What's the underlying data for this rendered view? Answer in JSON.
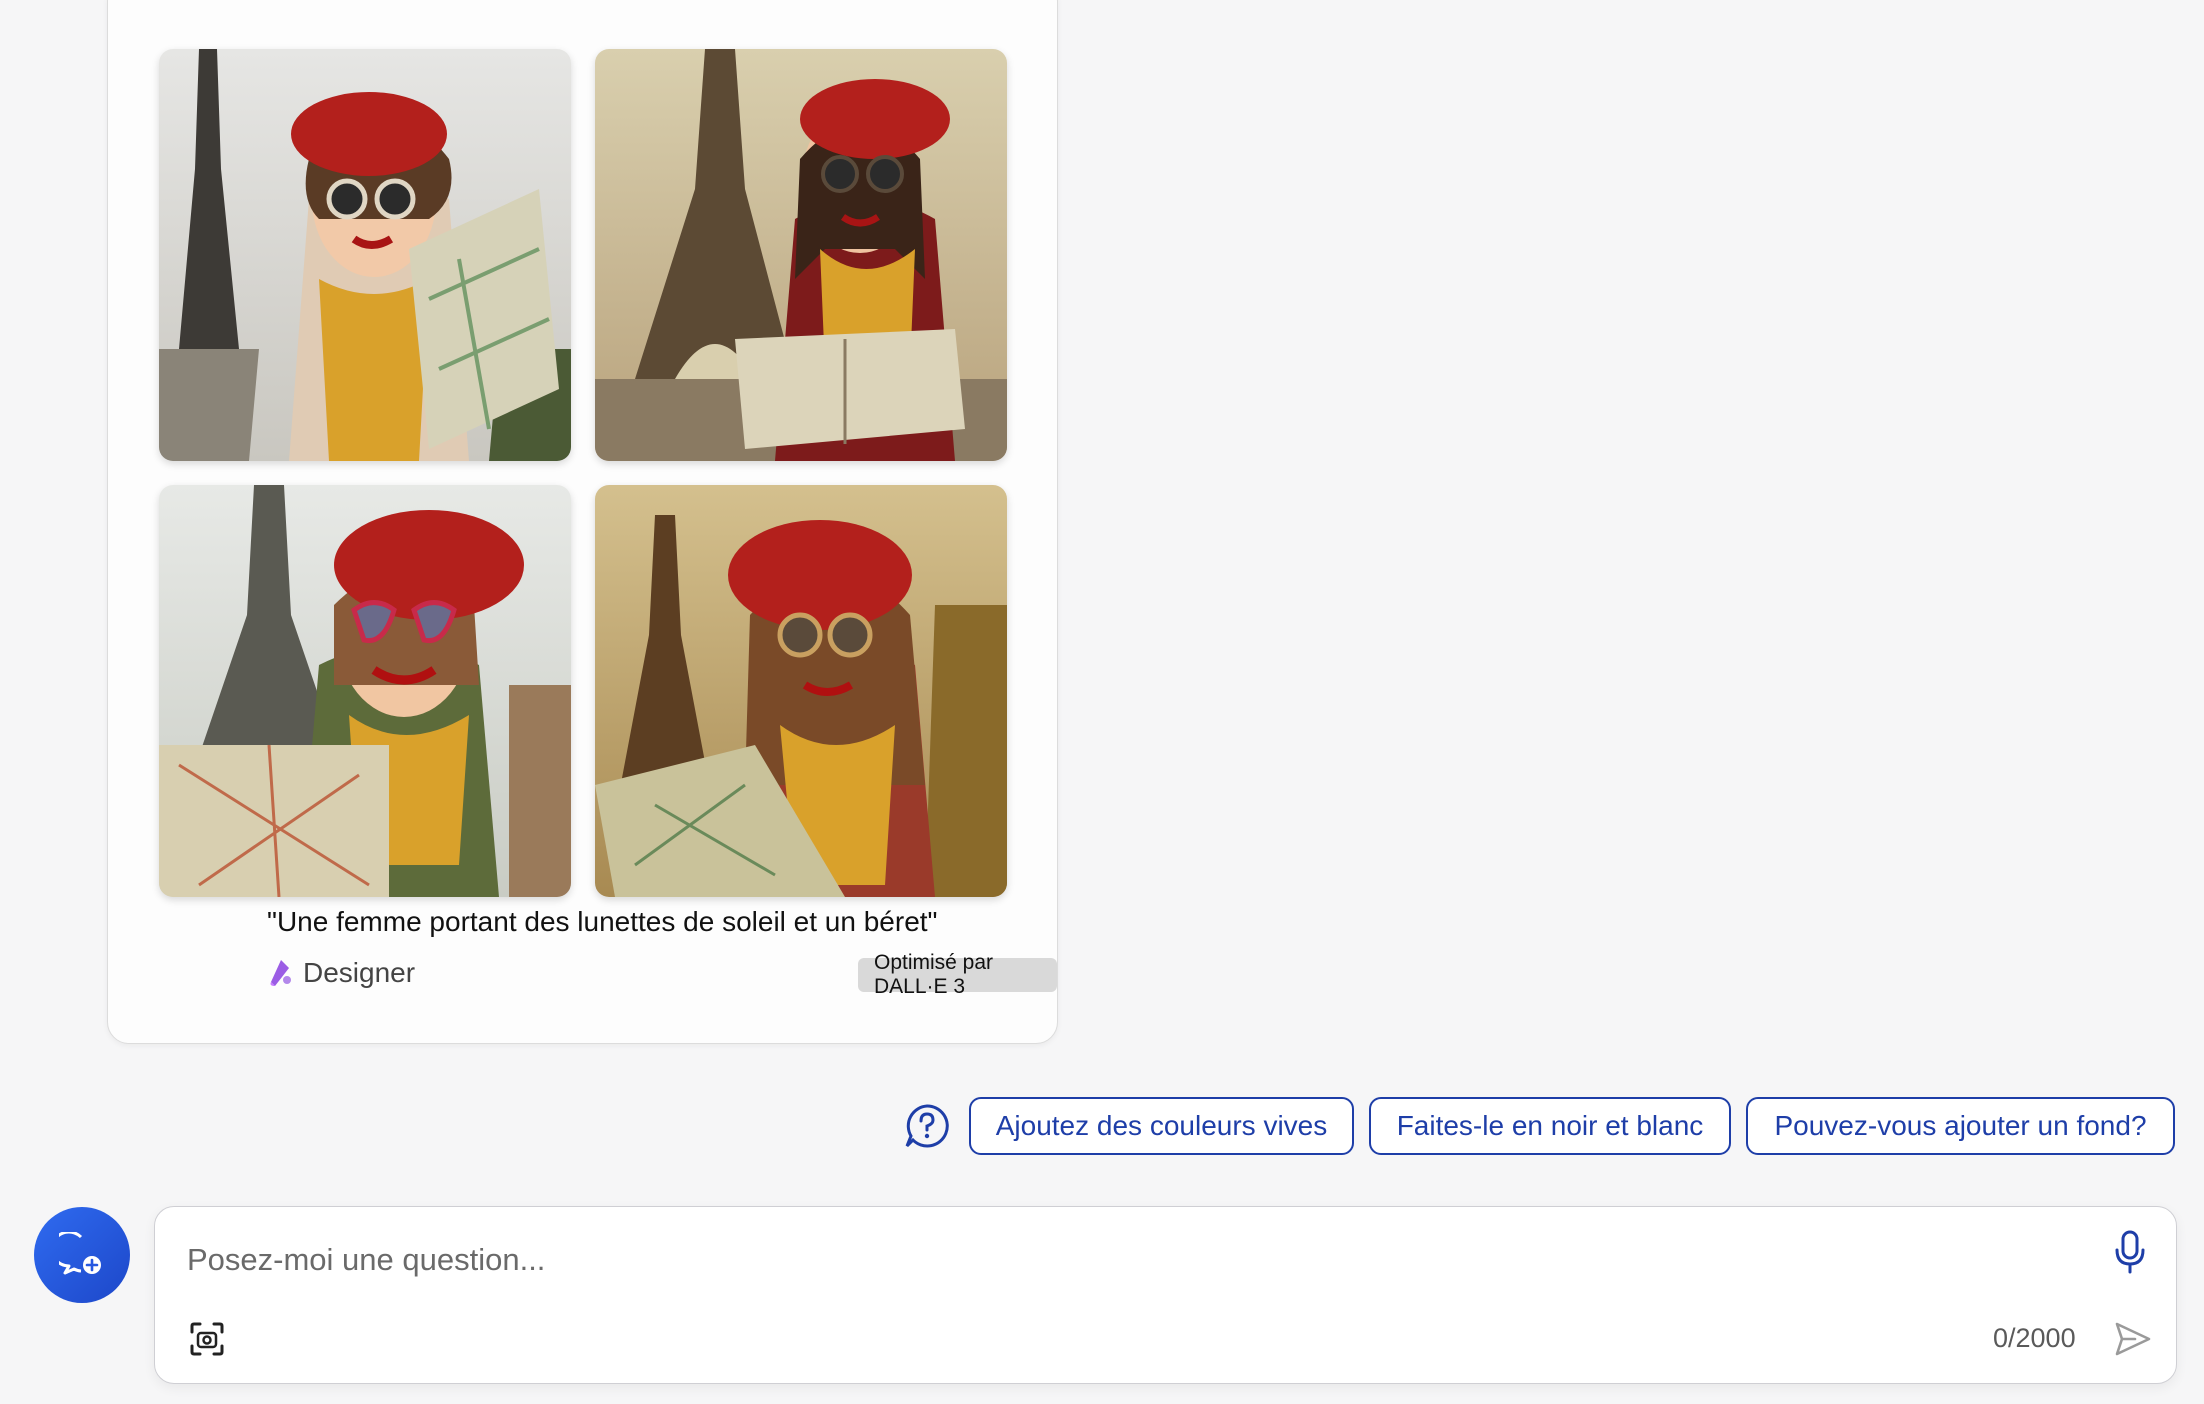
{
  "result_card": {
    "images": [
      {
        "alt": "woman-beret-eiffel-1"
      },
      {
        "alt": "woman-beret-eiffel-2"
      },
      {
        "alt": "woman-beret-eiffel-3"
      },
      {
        "alt": "woman-beret-eiffel-4"
      }
    ],
    "caption": "\"Une femme portant des lunettes de soleil et un béret\"",
    "designer_label": "Designer",
    "powered_by": "Optimisé par DALL·E 3"
  },
  "suggestions": {
    "icon": "help-chat-icon",
    "chips": [
      "Ajoutez des couleurs vives",
      "Faites-le en noir et blanc",
      "Pouvez-vous ajouter un fond?"
    ]
  },
  "composer": {
    "placeholder": "Posez-moi une question...",
    "value": "",
    "char_count": "0/2000",
    "icons": [
      "new-chat-icon",
      "microphone-icon",
      "visual-search-icon",
      "send-icon"
    ]
  },
  "colors": {
    "accent": "#1e3ea8",
    "new_chat_button": "#2758e0",
    "beret_red": "#b3201c",
    "scarf_yellow": "#d9a12b"
  }
}
